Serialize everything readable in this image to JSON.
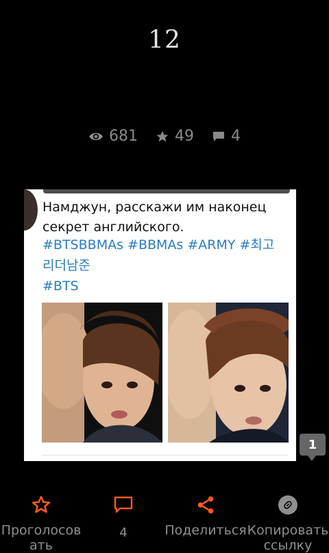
{
  "header": {
    "page_number": "12"
  },
  "stats": {
    "views": "681",
    "rating": "49",
    "comments": "4"
  },
  "post": {
    "tweet_text": "Намджун, расскажи им наконец секрет английского.",
    "hashtags_line1": "#BTSBBMAs #BBMAs #ARMY #최고",
    "hashtags_line2": "리더남준",
    "hashtags_line3": "#BTS"
  },
  "comment_badge": "1",
  "actions": {
    "vote_label": "Проголосов\nать",
    "comments_count": "4",
    "share_label": "Поделиться",
    "copy_label": "Копировать\nссылку"
  },
  "colors": {
    "accent": "#ff5a1f",
    "muted": "#8f8f8f",
    "hashtag": "#2b7bbf"
  },
  "icons": [
    "eye-icon",
    "star-icon",
    "comment-icon",
    "share-icon",
    "link-icon"
  ]
}
